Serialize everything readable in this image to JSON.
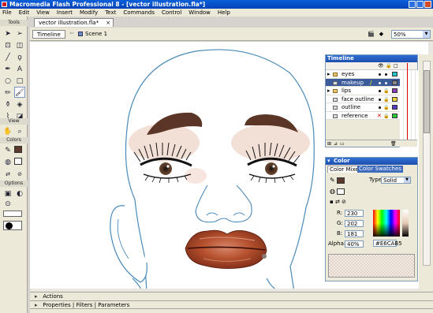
{
  "window": {
    "title": "Macromedia Flash Professional 8 - [vector illustration.fla*]"
  },
  "menu": [
    "File",
    "Edit",
    "View",
    "Insert",
    "Modify",
    "Text",
    "Commands",
    "Control",
    "Window",
    "Help"
  ],
  "tools_panel": {
    "title": "Tools",
    "view_label": "View",
    "colors_label": "Colors",
    "options_label": "Options"
  },
  "document": {
    "tab_label": "vector illustration.fla*",
    "timeline_button": "Timeline",
    "scene_label": "Scene 1",
    "zoom_value": "50%"
  },
  "timeline_panel": {
    "title": "Timeline",
    "layers": [
      {
        "name": "eyes",
        "type": "folder",
        "color": "#27c6c6"
      },
      {
        "name": "makeup",
        "type": "layer",
        "selected": true,
        "color": "#8a8a8a"
      },
      {
        "name": "lips",
        "type": "folder",
        "color": "#8a3fb8"
      },
      {
        "name": "face outline",
        "type": "layer",
        "color": "#e8d23a"
      },
      {
        "name": "outline",
        "type": "layer",
        "color": "#5a36c8"
      },
      {
        "name": "reference",
        "type": "layer",
        "color": "#28c83a"
      }
    ]
  },
  "color_panel": {
    "title": "Color",
    "tabs": [
      "Color Mixer",
      "Color Swatches"
    ],
    "type_label": "Type:",
    "type_value": "Solid",
    "r_label": "R:",
    "r_value": "230",
    "g_label": "G:",
    "g_value": "202",
    "b_label": "B:",
    "b_value": "181",
    "alpha_label": "Alpha:",
    "alpha_value": "40%",
    "hex_value": "#E6CAB5",
    "fill_color": "#E6CAB5"
  },
  "bottom_panels": {
    "actions": "Actions",
    "properties": "Properties",
    "filters": "Filters",
    "parameters": "Parameters"
  }
}
